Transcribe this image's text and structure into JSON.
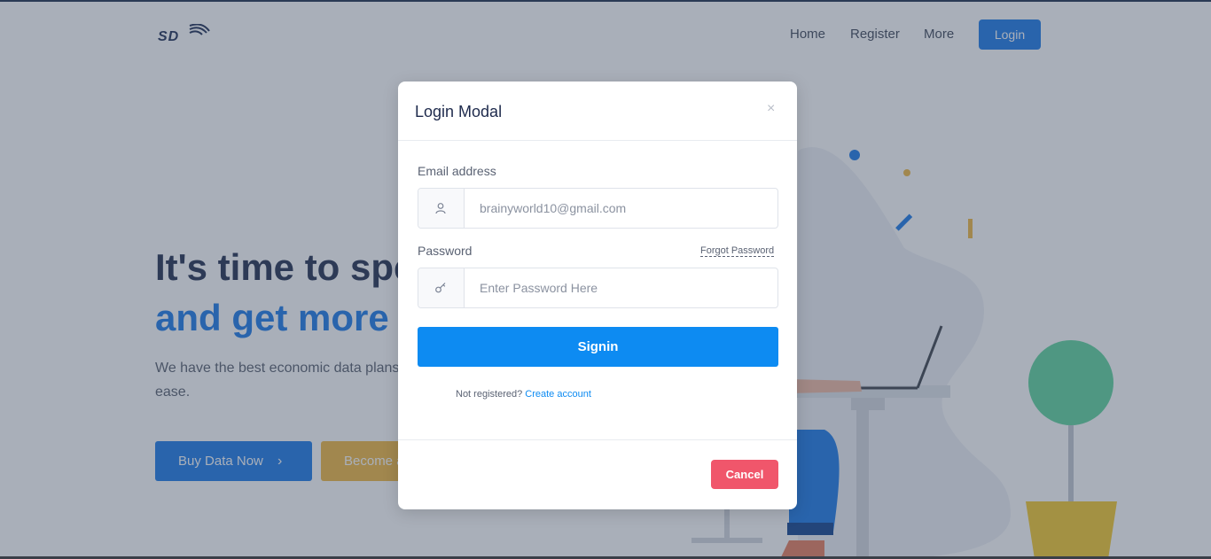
{
  "nav": {
    "logo_text": "SD",
    "links": [
      "Home",
      "Register",
      "More"
    ],
    "login_label": "Login"
  },
  "hero": {
    "title_line1": "It's time to spe",
    "title_line2": "and get more",
    "description": "We have the best economic data plans cheaper rate with ease.",
    "buy_button": "Buy Data Now",
    "become_button": "Become a"
  },
  "modal": {
    "title": "Login Modal",
    "close_symbol": "×",
    "email_label": "Email address",
    "email_value": "brainyworld10@gmail.com",
    "password_label": "Password",
    "forgot_password": "Forgot Password",
    "password_placeholder": "Enter Password Here",
    "signin_label": "Signin",
    "not_registered": "Not registered?",
    "create_account": "Create account",
    "cancel_label": "Cancel"
  },
  "icons": {
    "email_field": "user-icon",
    "password_field": "key-icon",
    "buy_button": "chevron-right-icon"
  },
  "colors": {
    "primary": "#1777e8",
    "signin": "#0d8bf2",
    "cancel": "#f0566b",
    "warning": "#f0b73d",
    "heading": "#1e2a4c"
  }
}
